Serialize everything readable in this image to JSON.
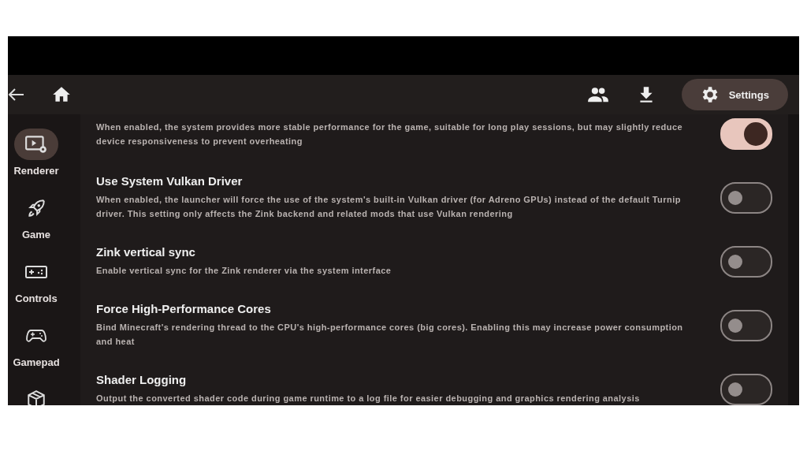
{
  "top_bar": {
    "actions": [
      {
        "kind": "people"
      },
      {
        "kind": "download"
      }
    ],
    "settings_button": {
      "label": "Settings",
      "selected": true
    }
  },
  "sidebar": {
    "items": [
      {
        "kind": "renderer",
        "label": "Renderer",
        "selected": true
      },
      {
        "kind": "game",
        "label": "Game",
        "selected": false
      },
      {
        "kind": "controls",
        "label": "Controls",
        "selected": false
      },
      {
        "kind": "gamepad",
        "label": "Gamepad",
        "selected": false
      },
      {
        "kind": "package",
        "selected": false
      }
    ]
  },
  "settings": [
    {
      "description": "When enabled, the system provides more stable performance for the game, suitable for long play sessions, but may slightly reduce device responsiveness to prevent overheating",
      "on": true
    },
    {
      "title": "Use System Vulkan Driver",
      "description": "When enabled, the launcher will force the use of the system's built-in Vulkan driver (for Adreno GPUs) instead of the default Turnip driver. This setting only affects the Zink backend and related mods that use Vulkan rendering",
      "on": false
    },
    {
      "title": "Zink vertical sync",
      "description": "Enable vertical sync for the Zink renderer via the system interface",
      "on": false
    },
    {
      "title": "Force High-Performance Cores",
      "description": "Bind Minecraft's rendering thread to the CPU's high-performance cores (big cores). Enabling this may increase power consumption and heat",
      "on": false
    },
    {
      "title": "Shader Logging",
      "description": "Output the converted shader code during game runtime to a log file for easier debugging and graphics rendering analysis",
      "on": false
    }
  ]
}
